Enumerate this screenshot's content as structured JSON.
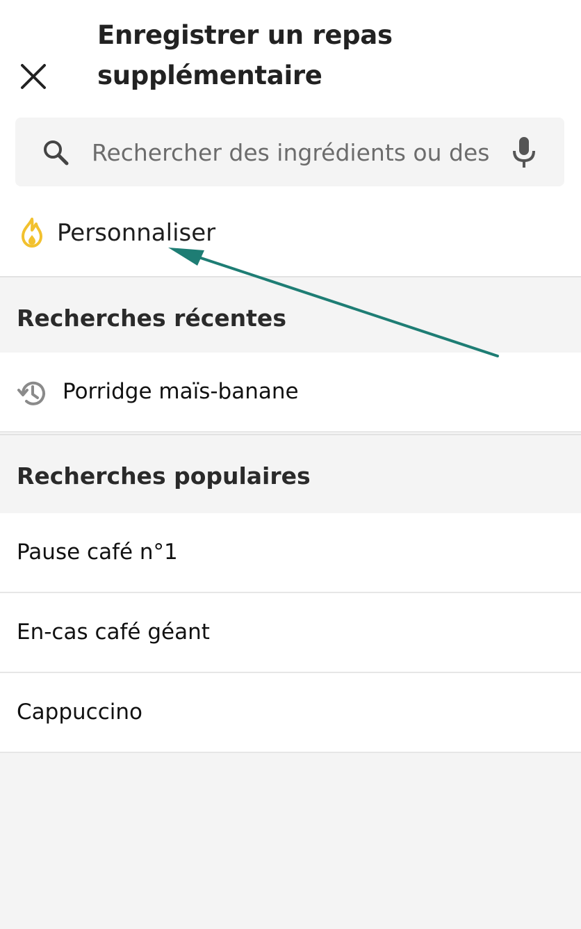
{
  "header": {
    "title_line1": "Enregistrer un repas",
    "title_line2": "supplémentaire",
    "close_icon": "close-icon"
  },
  "search": {
    "placeholder": "Rechercher des ingrédients ou des",
    "value": "",
    "search_icon": "search-icon",
    "mic_icon": "microphone-icon"
  },
  "personalize": {
    "label": "Personnaliser",
    "icon": "flame-icon",
    "icon_color": "#f2c12e"
  },
  "recent": {
    "title": "Recherches récentes",
    "items": [
      {
        "label": "Porridge maïs-banane",
        "icon": "history-icon"
      }
    ]
  },
  "popular": {
    "title": "Recherches populaires",
    "items": [
      {
        "label": "Pause café n°1"
      },
      {
        "label": "En-cas café géant"
      },
      {
        "label": "Cappuccino"
      }
    ]
  },
  "colors": {
    "annotation_arrow": "#1e7d74",
    "section_background": "#f4f4f4",
    "row_background": "#ffffff"
  }
}
